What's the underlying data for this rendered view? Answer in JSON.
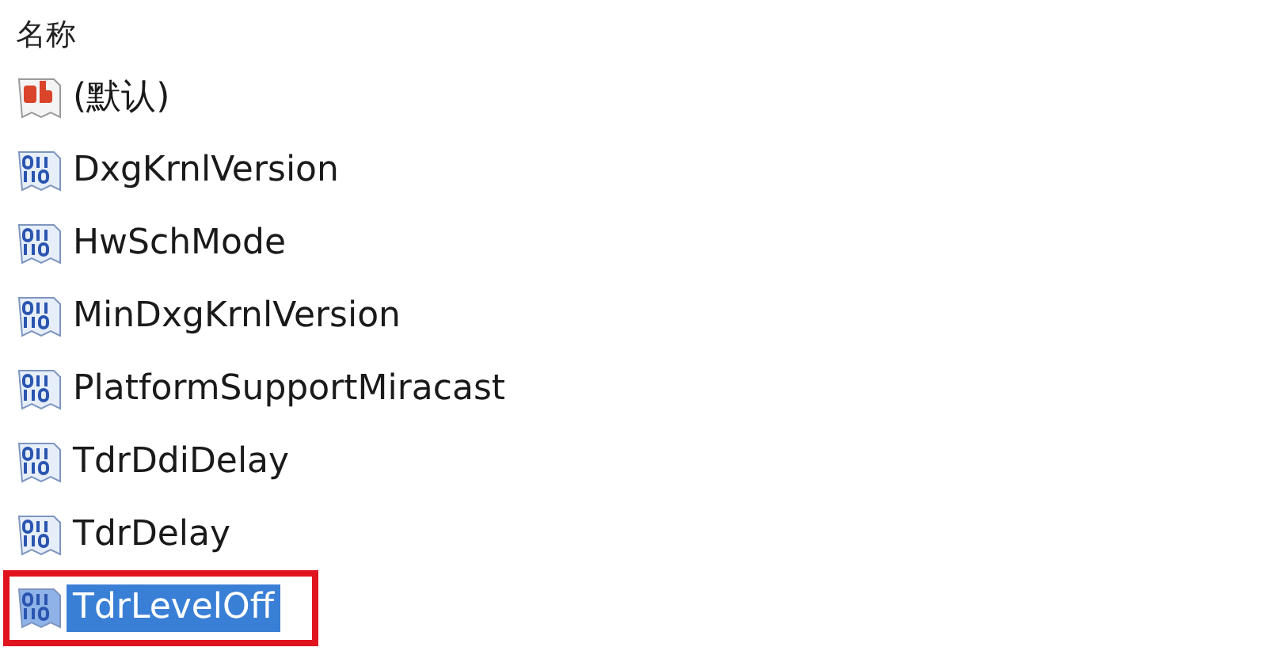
{
  "column_header": "名称",
  "values": [
    {
      "name": "(默认)",
      "kind": "string",
      "selected": false,
      "marked": false
    },
    {
      "name": "DxgKrnlVersion",
      "kind": "binary",
      "selected": false,
      "marked": false
    },
    {
      "name": "HwSchMode",
      "kind": "binary",
      "selected": false,
      "marked": false
    },
    {
      "name": "MinDxgKrnlVersion",
      "kind": "binary",
      "selected": false,
      "marked": false
    },
    {
      "name": "PlatformSupportMiracast",
      "kind": "binary",
      "selected": false,
      "marked": false
    },
    {
      "name": "TdrDdiDelay",
      "kind": "binary",
      "selected": false,
      "marked": false
    },
    {
      "name": "TdrDelay",
      "kind": "binary",
      "selected": false,
      "marked": false
    },
    {
      "name": "TdrLevelOff",
      "kind": "binary",
      "selected": true,
      "marked": true
    }
  ]
}
